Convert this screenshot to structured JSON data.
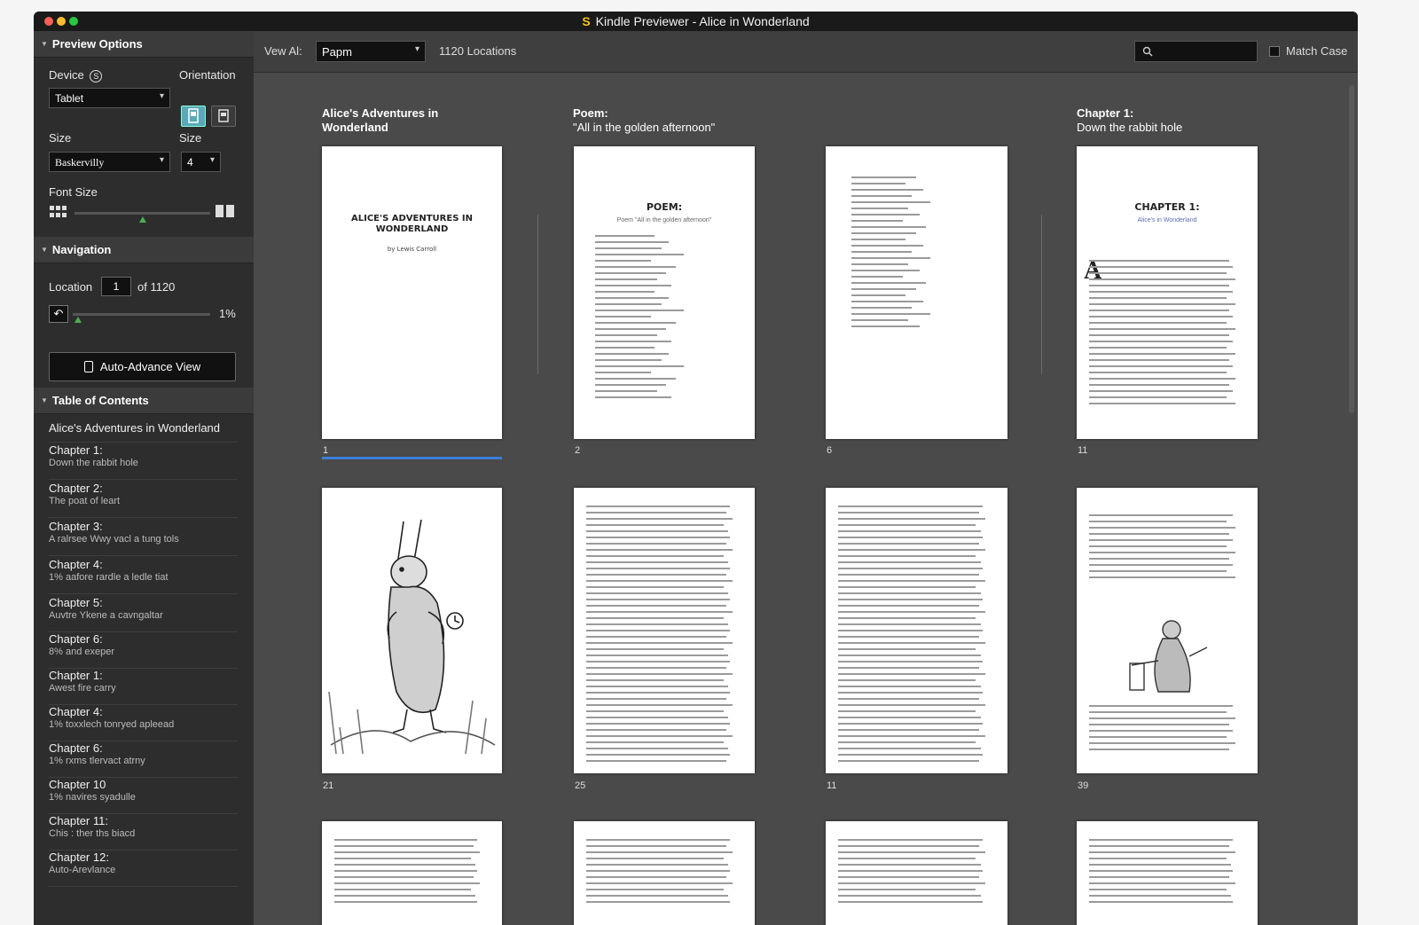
{
  "window": {
    "title": "Kindle Previewer - Alice in Wonderland",
    "app_icon": "S",
    "traffic_lights": [
      "#ff5f57",
      "#febc2e",
      "#28c840"
    ]
  },
  "sidebar": {
    "preview_options": {
      "header": "Preview Options",
      "device_label": "Device",
      "device_badge": "S",
      "device_value": "Tablet",
      "orientation_label": "Orientation",
      "orientation_options": [
        "portrait",
        "landscape"
      ],
      "size_label": "Size",
      "font_value": "Baskervilly",
      "size2_label": "Size",
      "size_value": "4",
      "font_size_label": "Font Size",
      "font_size_level": 0.5
    },
    "navigation": {
      "header": "Navigation",
      "location_label": "Location",
      "location_value": "1",
      "of_label": "of 1120",
      "percent": "1%",
      "progress": 0.01,
      "auto_advance_label": "Auto-Advance View"
    },
    "toc": {
      "header": "Table of Contents",
      "items": [
        {
          "title": "Alice's Adventures in Wonderland",
          "sub": ""
        },
        {
          "title": "Chapter 1:",
          "sub": "Down the rabbit hole"
        },
        {
          "title": "Chapter 2:",
          "sub": "The poat of leart"
        },
        {
          "title": "Chapter 3:",
          "sub": "A ralrsee Wwy vacl a tung tols"
        },
        {
          "title": "Chapter 4:",
          "sub": "1% aafore rardle a ledle tiat"
        },
        {
          "title": "Chapter 5:",
          "sub": "Auvtre Ykene a cavngaltar"
        },
        {
          "title": "Chapter 6:",
          "sub": "8% and exeper"
        },
        {
          "title": "Chapter 1:",
          "sub": "Awest fire carry"
        },
        {
          "title": "Chapter 4:",
          "sub": "1% toxxlech tonryed apleead"
        },
        {
          "title": "Chapter 6:",
          "sub": "1% rxms tlervact atrny"
        },
        {
          "title": "Chapter 10",
          "sub": "1% navires syadulle"
        },
        {
          "title": "Chapter 11:",
          "sub": "Chis : ther ths biacd"
        },
        {
          "title": "Chapter 12:",
          "sub": "Auto-Arevlance"
        }
      ]
    }
  },
  "toolbar": {
    "view_label": "Vew Al:",
    "view_value": "Papm",
    "locations": "1120 Locations",
    "search_placeholder": "",
    "match_case_label": "Match Case",
    "match_case_checked": false
  },
  "columns": [
    {
      "title": "Alice's Adventures in",
      "sub": "Wonderland",
      "sub_bold": true
    },
    {
      "title": "Poem:",
      "sub": "\"All in the golden afternoon\"",
      "sub_bold": false
    },
    {
      "title": "",
      "sub": "",
      "sub_bold": false
    },
    {
      "title": "Chapter 1:",
      "sub": "Down the rabbit hole",
      "sub_bold": false
    }
  ],
  "pages": {
    "row1": [
      {
        "num": "1",
        "kind": "cover",
        "heading": "ALICE'S ADVENTURES IN WONDERLAND",
        "byline": "by Lewis Carroll",
        "selected": true
      },
      {
        "num": "2",
        "kind": "poem",
        "heading": "POEM:",
        "byline": "Poem \"All in the golden afternoon\"",
        "selected": false
      },
      {
        "num": "6",
        "kind": "poemcont",
        "heading": "",
        "byline": "",
        "selected": false
      },
      {
        "num": "11",
        "kind": "chapter",
        "heading": "CHAPTER 1:",
        "byline": "Alice's in Wonderland",
        "selected": false
      }
    ],
    "row2": [
      {
        "num": "21",
        "kind": "illustration"
      },
      {
        "num": "25",
        "kind": "text"
      },
      {
        "num": "11",
        "kind": "text"
      },
      {
        "num": "39",
        "kind": "textillus"
      }
    ],
    "row3": [
      {
        "num": "",
        "kind": "text"
      },
      {
        "num": "",
        "kind": "text"
      },
      {
        "num": "",
        "kind": "text"
      },
      {
        "num": "",
        "kind": "text"
      }
    ]
  },
  "colors": {
    "accent_blue": "#3d7fd9",
    "thumb_green": "#4caf50",
    "sidebar_bg": "#2d2d2d",
    "main_bg": "#4a4a4a"
  }
}
